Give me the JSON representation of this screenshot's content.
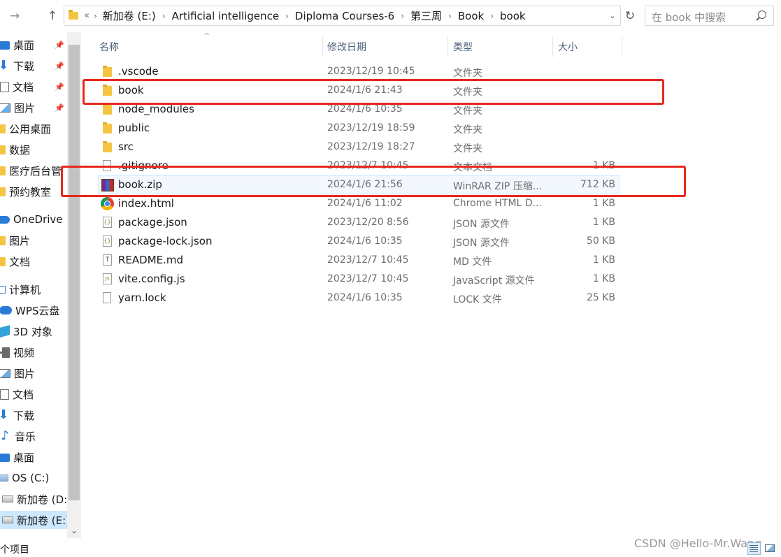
{
  "toolbar": {
    "forward_icon": "→",
    "up_icon": "↑",
    "refresh_icon": "↻",
    "dropdown_icon": "⌄"
  },
  "address": {
    "overflow": "«",
    "separator": "›",
    "crumbs": [
      "新加卷 (E:)",
      "Artificial intelligence",
      "Diploma Courses-6",
      "第三周",
      "Book",
      "book"
    ]
  },
  "search": {
    "placeholder": "在 book 中搜索"
  },
  "sidebar": {
    "items": [
      {
        "label": "桌面",
        "icon": "desktop-icon",
        "pinned": true
      },
      {
        "label": "下载",
        "icon": "download-icon",
        "pinned": true
      },
      {
        "label": "文档",
        "icon": "document-icon",
        "pinned": true
      },
      {
        "label": "图片",
        "icon": "picture-icon",
        "pinned": true
      },
      {
        "label": "公用桌面",
        "icon": "folder-icon"
      },
      {
        "label": "数据",
        "icon": "folder-icon"
      },
      {
        "label": "医疗后台管",
        "icon": "folder-icon"
      },
      {
        "label": "预约教室",
        "icon": "folder-icon"
      },
      {
        "label": "OneDrive",
        "icon": "cloud-icon"
      },
      {
        "label": "图片",
        "icon": "folder-icon"
      },
      {
        "label": "文档",
        "icon": "folder-icon"
      },
      {
        "label": "计算机",
        "icon": "computer-icon"
      },
      {
        "label": "WPS云盘",
        "icon": "wps-cloud-icon"
      },
      {
        "label": "3D 对象",
        "icon": "3d-objects-icon"
      },
      {
        "label": "视频",
        "icon": "video-icon"
      },
      {
        "label": "图片",
        "icon": "picture-icon"
      },
      {
        "label": "文档",
        "icon": "document-icon"
      },
      {
        "label": "下载",
        "icon": "download-icon"
      },
      {
        "label": "音乐",
        "icon": "music-icon"
      },
      {
        "label": "桌面",
        "icon": "desktop-icon"
      },
      {
        "label": "OS (C:)",
        "icon": "drive-icon"
      },
      {
        "label": "新加卷 (D:)",
        "icon": "drive-icon"
      },
      {
        "label": "新加卷 (E:)",
        "icon": "drive-icon",
        "selected": true
      }
    ],
    "pin_icon": "📌",
    "scroll_down_icon": "⌄"
  },
  "columns": {
    "name": "名称",
    "date": "修改日期",
    "type": "类型",
    "size": "大小",
    "sort_indicator": "^"
  },
  "files": [
    {
      "name": ".vscode",
      "date": "2023/12/19 10:45",
      "type": "文件夹",
      "size": "",
      "icon": "folder-icon"
    },
    {
      "name": "book",
      "date": "2024/1/6 21:43",
      "type": "文件夹",
      "size": "",
      "icon": "folder-icon"
    },
    {
      "name": "node_modules",
      "date": "2024/1/6 10:35",
      "type": "文件夹",
      "size": "",
      "icon": "folder-icon"
    },
    {
      "name": "public",
      "date": "2023/12/19 18:59",
      "type": "文件夹",
      "size": "",
      "icon": "folder-icon"
    },
    {
      "name": "src",
      "date": "2023/12/19 18:27",
      "type": "文件夹",
      "size": "",
      "icon": "folder-icon"
    },
    {
      "name": ".gitignore",
      "date": "2023/12/7 10:45",
      "type": "文本文档",
      "size": "1 KB",
      "icon": "text-file-icon"
    },
    {
      "name": "book.zip",
      "date": "2024/1/6 21:56",
      "type": "WinRAR ZIP 压缩...",
      "size": "712 KB",
      "icon": "winrar-zip-icon",
      "selected": true
    },
    {
      "name": "index.html",
      "date": "2024/1/6 11:02",
      "type": "Chrome HTML D...",
      "size": "1 KB",
      "icon": "chrome-html-icon"
    },
    {
      "name": "package.json",
      "date": "2023/12/20 8:56",
      "type": "JSON 源文件",
      "size": "1 KB",
      "icon": "json-file-icon"
    },
    {
      "name": "package-lock.json",
      "date": "2024/1/6 10:35",
      "type": "JSON 源文件",
      "size": "50 KB",
      "icon": "json-file-icon"
    },
    {
      "name": "README.md",
      "date": "2023/12/7 10:45",
      "type": "MD 文件",
      "size": "1 KB",
      "icon": "md-file-icon"
    },
    {
      "name": "vite.config.js",
      "date": "2023/12/7 10:45",
      "type": "JavaScript 源文件",
      "size": "1 KB",
      "icon": "js-file-icon"
    },
    {
      "name": "yarn.lock",
      "date": "2024/1/6 10:35",
      "type": "LOCK 文件",
      "size": "25 KB",
      "icon": "file-icon"
    }
  ],
  "status": {
    "text": "个项目"
  },
  "watermark": "CSDN @Hello-Mr.Wang",
  "colors": {
    "highlight": "#e8281e",
    "selection": "#cce8ff",
    "accent": "#2a7bd6"
  }
}
